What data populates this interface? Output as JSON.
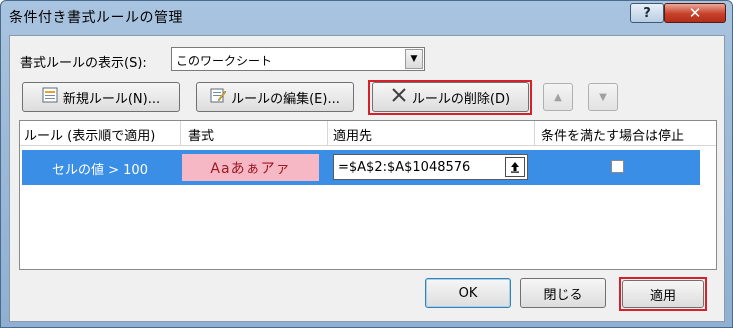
{
  "window": {
    "title": "条件付き書式ルールの管理",
    "help_label": "?",
    "close_label": "✕"
  },
  "show_rules": {
    "label": "書式ルールの表示(S):",
    "selected": "このワークシート"
  },
  "toolbar": {
    "new_rule": "新規ルール(N)...",
    "edit_rule": "ルールの編集(E)...",
    "delete_rule": "ルールの削除(D)"
  },
  "table": {
    "headers": [
      "ルール (表示順で適用)",
      "書式",
      "適用先",
      "条件を満たす場合は停止"
    ],
    "rows": [
      {
        "rule": "セルの値 > 100",
        "format_preview": "Aaあぁアァ",
        "applies_to": "=$A$2:$A$1048576",
        "stop_if_true": false
      }
    ]
  },
  "footer": {
    "ok": "OK",
    "close": "閉じる",
    "apply": "適用"
  },
  "colors": {
    "selection": "#3a8ee6",
    "highlight": "#d8202a",
    "format_bg": "#f6b8c4",
    "format_fg": "#9a1a22"
  }
}
